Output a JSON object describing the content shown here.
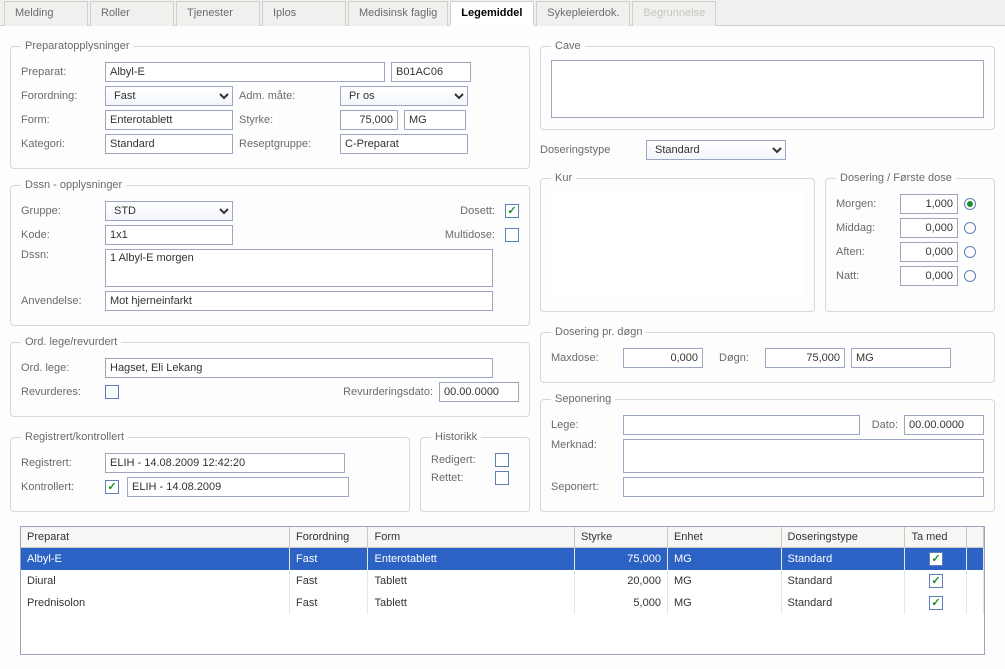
{
  "tabs": {
    "melding": "Melding",
    "roller": "Roller",
    "tjenester": "Tjenester",
    "iplos": "Iplos",
    "medisinsk": "Medisinsk faglig",
    "legemiddel": "Legemiddel",
    "sykepleier": "Sykepleierdok.",
    "begrunnelse": "Begrunnelse"
  },
  "preparat": {
    "legend": "Preparatopplysninger",
    "preparat_label": "Preparat:",
    "preparat_value": "Albyl-E",
    "atc": "B01AC06",
    "forordning_label": "Forordning:",
    "forordning_value": "Fast",
    "adm_label": "Adm. måte:",
    "adm_value": "Pr os",
    "form_label": "Form:",
    "form_value": "Enterotablett",
    "styrke_label": "Styrke:",
    "styrke_value": "75,000",
    "styrke_unit": "MG",
    "kategori_label": "Kategori:",
    "kategori_value": "Standard",
    "resept_label": "Reseptgruppe:",
    "resept_value": "C-Preparat"
  },
  "cave": {
    "legend": "Cave",
    "text": ""
  },
  "dssn": {
    "legend": "Dssn - opplysninger",
    "gruppe_label": "Gruppe:",
    "gruppe_value": "STD",
    "dosett_label": "Dosett:",
    "kode_label": "Kode:",
    "kode_value": "1x1",
    "multidose_label": "Multidose:",
    "dssn_label": "Dssn:",
    "dssn_value": "1 Albyl-E morgen",
    "anvendelse_label": "Anvendelse:",
    "anvendelse_value": "Mot hjerneinfarkt"
  },
  "dostype": {
    "label": "Doseringstype",
    "value": "Standard"
  },
  "kur": {
    "legend": "Kur",
    "text": ""
  },
  "dosering": {
    "legend": "Dosering / Første dose",
    "morgen_label": "Morgen:",
    "morgen_value": "1,000",
    "middag_label": "Middag:",
    "middag_value": "0,000",
    "aften_label": "Aften:",
    "aften_value": "0,000",
    "natt_label": "Natt:",
    "natt_value": "0,000"
  },
  "ordlege": {
    "legend": "Ord. lege/revurdert",
    "lege_label": "Ord. lege:",
    "lege_value": "Hagset, Eli Lekang",
    "revurderes_label": "Revurderes:",
    "revdato_label": "Revurderingsdato:",
    "revdato_value": "00.00.0000"
  },
  "dospdogn": {
    "legend": "Dosering pr. døgn",
    "max_label": "Maxdose:",
    "max_value": "0,000",
    "dogn_label": "Døgn:",
    "dogn_value": "75,000",
    "unit": "MG"
  },
  "sepon": {
    "legend": "Seponering",
    "lege_label": "Lege:",
    "lege_value": "",
    "dato_label": "Dato:",
    "dato_value": "00.00.0000",
    "merknad_label": "Merknad:",
    "merknad_value": "",
    "seponert_label": "Seponert:",
    "seponert_value": ""
  },
  "reg": {
    "legend": "Registrert/kontrollert",
    "reg_label": "Registrert:",
    "reg_value": "ELIH - 14.08.2009 12:42:20",
    "kontr_label": "Kontrollert:",
    "kontr_value": "ELIH - 14.08.2009"
  },
  "historikk": {
    "legend": "Historikk",
    "redigert_label": "Redigert:",
    "rettet_label": "Rettet:"
  },
  "table": {
    "headers": {
      "preparat": "Preparat",
      "forordning": "Forordning",
      "form": "Form",
      "styrke": "Styrke",
      "enhet": "Enhet",
      "dostype": "Doseringstype",
      "tamed": "Ta med"
    },
    "rows": [
      {
        "preparat": "Albyl-E",
        "forordning": "Fast",
        "form": "Enterotablett",
        "styrke": "75,000",
        "enhet": "MG",
        "dostype": "Standard",
        "tamed": true,
        "selected": true
      },
      {
        "preparat": "Diural",
        "forordning": "Fast",
        "form": "Tablett",
        "styrke": "20,000",
        "enhet": "MG",
        "dostype": "Standard",
        "tamed": true,
        "selected": false
      },
      {
        "preparat": "Prednisolon",
        "forordning": "Fast",
        "form": "Tablett",
        "styrke": "5,000",
        "enhet": "MG",
        "dostype": "Standard",
        "tamed": true,
        "selected": false
      }
    ]
  }
}
